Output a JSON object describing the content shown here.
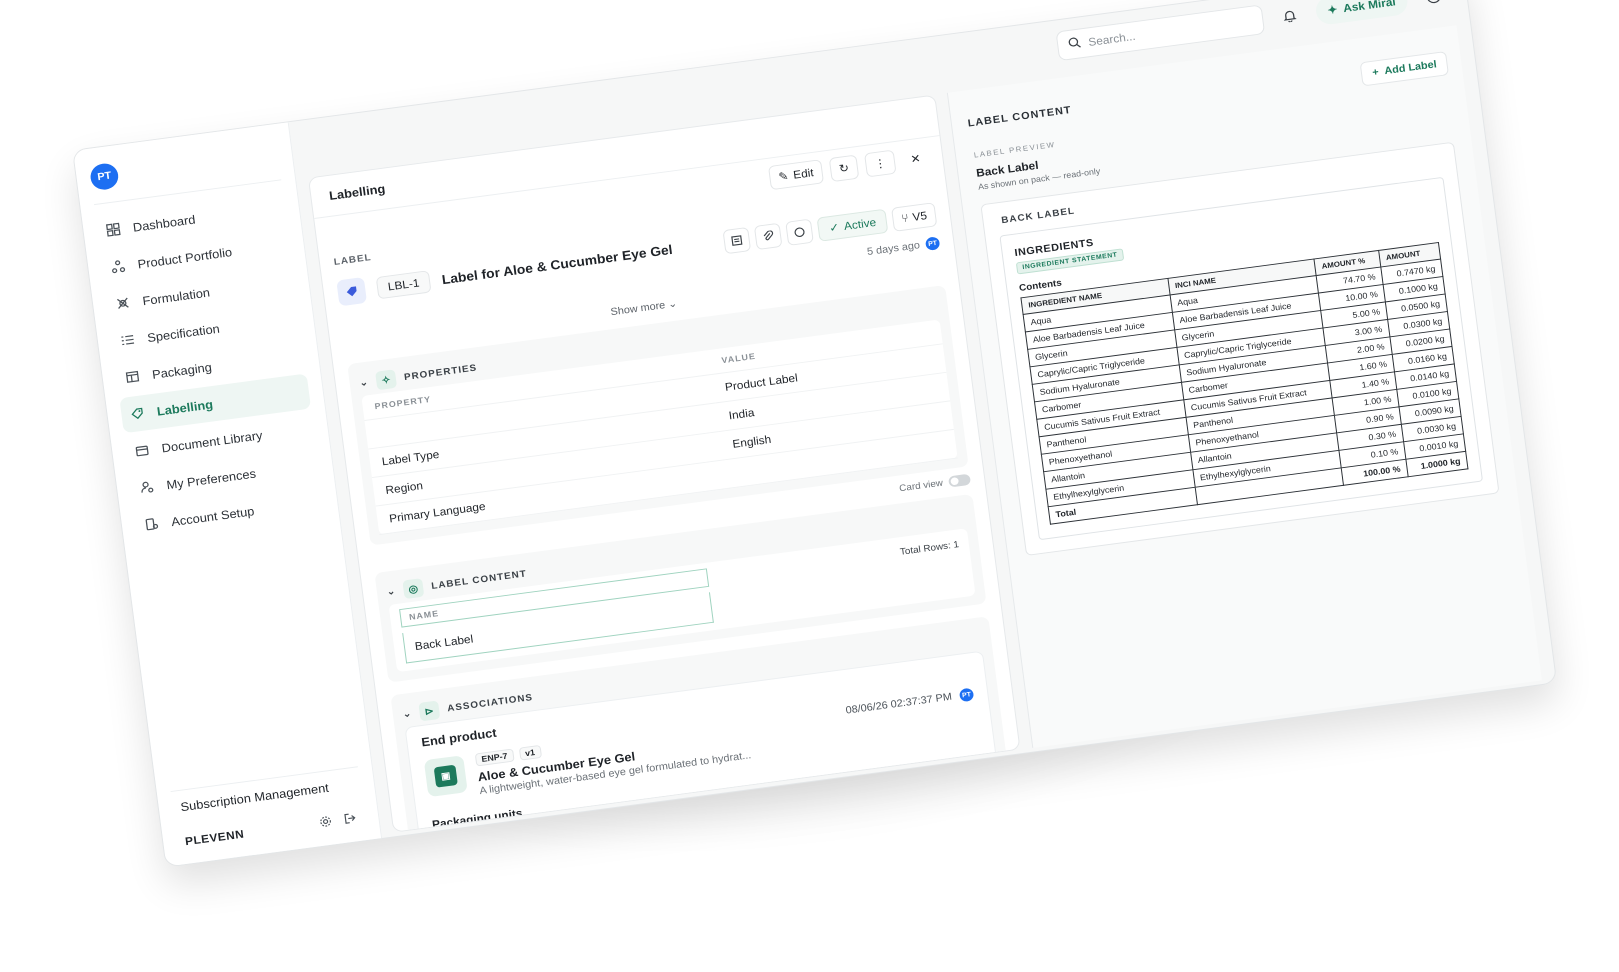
{
  "user": {
    "initials": "PT"
  },
  "sidebar": {
    "items": [
      {
        "label": "Dashboard",
        "icon": "grid-icon"
      },
      {
        "label": "Product Portfolio",
        "icon": "nodes-icon"
      },
      {
        "label": "Formulation",
        "icon": "flask-icon"
      },
      {
        "label": "Specification",
        "icon": "list-icon"
      },
      {
        "label": "Packaging",
        "icon": "box-icon"
      },
      {
        "label": "Labelling",
        "icon": "tag-icon",
        "active": true
      },
      {
        "label": "Document Library",
        "icon": "folder-icon"
      },
      {
        "label": "My Preferences",
        "icon": "user-settings-icon"
      },
      {
        "label": "Account Setup",
        "icon": "account-icon"
      }
    ],
    "subscription": "Subscription Management",
    "org": "PLEVENN"
  },
  "topbar": {
    "search_placeholder": "Search...",
    "ask_label": "Ask Mirai"
  },
  "main": {
    "title": "Labelling",
    "edit_label": "Edit",
    "section_label": "LABEL",
    "label_id": "LBL-1",
    "label_title": "Label for Aloe & Cucumber Eye Gel",
    "status": "Active",
    "version": "V5",
    "updated": "5 days ago",
    "show_more": "Show more",
    "properties": {
      "title": "PROPERTIES",
      "col_property": "PROPERTY",
      "col_value": "VALUE",
      "rows": [
        {
          "property": "",
          "value": "Product Label"
        },
        {
          "property": "Label Type",
          "value": "India"
        },
        {
          "property": "Region",
          "value": "English"
        },
        {
          "property": "Primary Language",
          "value": ""
        }
      ]
    },
    "card_view": "Card view",
    "label_content": {
      "title": "LABEL CONTENT",
      "col_name": "NAME",
      "total_rows": "Total Rows: 1",
      "rows": [
        "Back Label"
      ]
    },
    "associations": {
      "title": "ASSOCIATIONS",
      "end_product_title": "End product",
      "product": {
        "id": "ENP-7",
        "version": "v1",
        "name": "Aloe & Cucumber Eye Gel",
        "description": "A lightweight, water-based eye gel formulated to hydrat...",
        "date": "08/06/26 02:37:37 PM"
      },
      "packaging_units": "Packaging units"
    }
  },
  "right": {
    "add_label": "Add Label",
    "title": "LABEL CONTENT",
    "preview_label": "LABEL PREVIEW",
    "preview_title": "Back Label",
    "preview_sub": "As shown on pack — read-only",
    "back_label": "BACK LABEL",
    "ingredients_title": "INGREDIENTS",
    "ingredients_badge": "INGREDIENT STATEMENT",
    "contents": "Contents",
    "table": {
      "headers": [
        "INGREDIENT NAME",
        "INCI NAME",
        "AMOUNT %",
        "AMOUNT"
      ],
      "rows": [
        [
          "Aqua",
          "Aqua",
          "74.70 %",
          "0.7470 kg"
        ],
        [
          "Aloe Barbadensis Leaf Juice",
          "Aloe Barbadensis Leaf Juice",
          "10.00 %",
          "0.1000 kg"
        ],
        [
          "Glycerin",
          "Glycerin",
          "5.00 %",
          "0.0500 kg"
        ],
        [
          "Caprylic/Capric Triglyceride",
          "Caprylic/Capric Triglyceride",
          "3.00 %",
          "0.0300 kg"
        ],
        [
          "Sodium Hyaluronate",
          "Sodium Hyaluronate",
          "2.00 %",
          "0.0200 kg"
        ],
        [
          "Carbomer",
          "Carbomer",
          "1.60 %",
          "0.0160 kg"
        ],
        [
          "Cucumis Sativus Fruit Extract",
          "Cucumis Sativus Fruit Extract",
          "1.40 %",
          "0.0140 kg"
        ],
        [
          "Panthenol",
          "Panthenol",
          "1.00 %",
          "0.0100 kg"
        ],
        [
          "Phenoxyethanol",
          "Phenoxyethanol",
          "0.90 %",
          "0.0090 kg"
        ],
        [
          "Allantoin",
          "Allantoin",
          "0.30 %",
          "0.0030 kg"
        ],
        [
          "Ethylhexylglycerin",
          "Ethylhexylglycerin",
          "0.10 %",
          "0.0010 kg"
        ]
      ],
      "total_label": "Total",
      "total_pct": "100.00 %",
      "total_amt": "1.0000 kg"
    }
  },
  "colors": {
    "accent": "#1c7a5c",
    "avatar": "#1d6ff2"
  }
}
